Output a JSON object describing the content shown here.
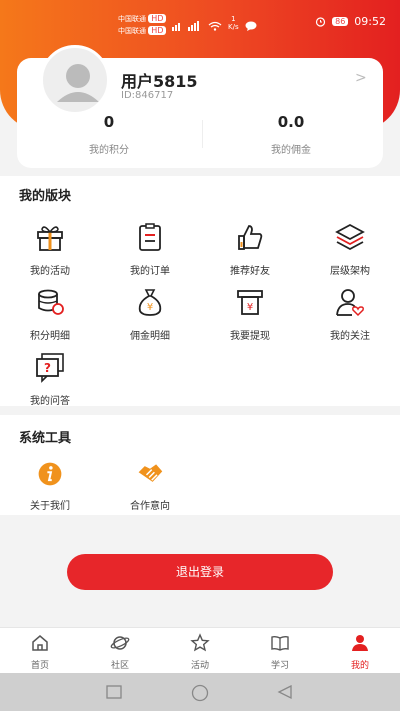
{
  "status_bar": {
    "carrier_1": "中国联通",
    "carrier_2": "中国联通",
    "hd": "HD",
    "speed_num": "1",
    "speed_unit": "K/s",
    "battery": "86",
    "time": "09:52"
  },
  "profile": {
    "username": "用户5815",
    "user_id": "ID:846717",
    "points_value": "0",
    "points_label": "我的积分",
    "commission_value": "0.0",
    "commission_label": "我的佣金"
  },
  "my_modules": {
    "title": "我的版块",
    "items": [
      {
        "label": "我的活动",
        "icon": "gift-icon"
      },
      {
        "label": "我的订单",
        "icon": "order-clipboard-icon"
      },
      {
        "label": "推荐好友",
        "icon": "thumbs-up-icon"
      },
      {
        "label": "层级架构",
        "icon": "layers-icon"
      },
      {
        "label": "积分明细",
        "icon": "coins-icon"
      },
      {
        "label": "佣金明细",
        "icon": "money-bag-icon"
      },
      {
        "label": "我要提现",
        "icon": "withdraw-icon"
      },
      {
        "label": "我的关注",
        "icon": "user-heart-icon"
      },
      {
        "label": "我的问答",
        "icon": "question-chat-icon"
      }
    ]
  },
  "system_tools": {
    "title": "系统工具",
    "items": [
      {
        "label": "关于我们",
        "icon": "info-icon"
      },
      {
        "label": "合作意向",
        "icon": "handshake-icon"
      }
    ]
  },
  "logout_label": "退出登录",
  "tabs": [
    {
      "label": "首页",
      "icon": "home-icon"
    },
    {
      "label": "社区",
      "icon": "planet-icon"
    },
    {
      "label": "活动",
      "icon": "star-icon"
    },
    {
      "label": "学习",
      "icon": "book-icon"
    },
    {
      "label": "我的",
      "icon": "profile-icon",
      "active": true
    }
  ],
  "colors": {
    "accent": "#e32020",
    "gradient_start": "#f5781a",
    "icon_orange": "#f0921c"
  }
}
